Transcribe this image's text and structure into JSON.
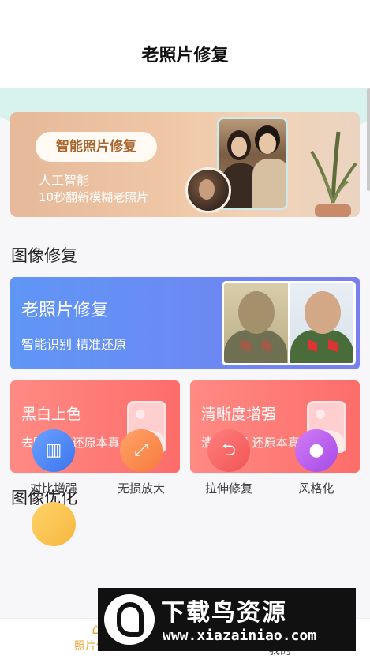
{
  "header": {
    "title": "老照片修复"
  },
  "banner": {
    "pill": "智能照片修复",
    "line1": "人工智能",
    "line2": "10秒翻新模糊老照片"
  },
  "sections": {
    "repair": "图像修复",
    "optimize": "图像优化"
  },
  "cards": {
    "old_photo": {
      "title": "老照片修复",
      "subtitle": "智能识别  精准还原"
    },
    "colorize": {
      "title": "黑白上色",
      "subtitle": "去除污损  还原本真"
    },
    "clarity": {
      "title": "清晰度增强",
      "subtitle": "清晰增强  还原本真"
    }
  },
  "optimize_items": [
    {
      "label": "对比增强",
      "icon": "contrast-icon",
      "color": "#4f86f5"
    },
    {
      "label": "无损放大",
      "icon": "enlarge-icon",
      "color": "#fb8f4f"
    },
    {
      "label": "拉伸修复",
      "icon": "stretch-icon",
      "color": "#fb6b6b"
    },
    {
      "label": "风格化",
      "icon": "style-icon",
      "color": "#b95ef0"
    }
  ],
  "bottom_nav": {
    "home": "照片修复",
    "mine": "我的"
  },
  "watermark": {
    "brand": "下载鸟资源",
    "url": "www.xiazainiao.com"
  }
}
